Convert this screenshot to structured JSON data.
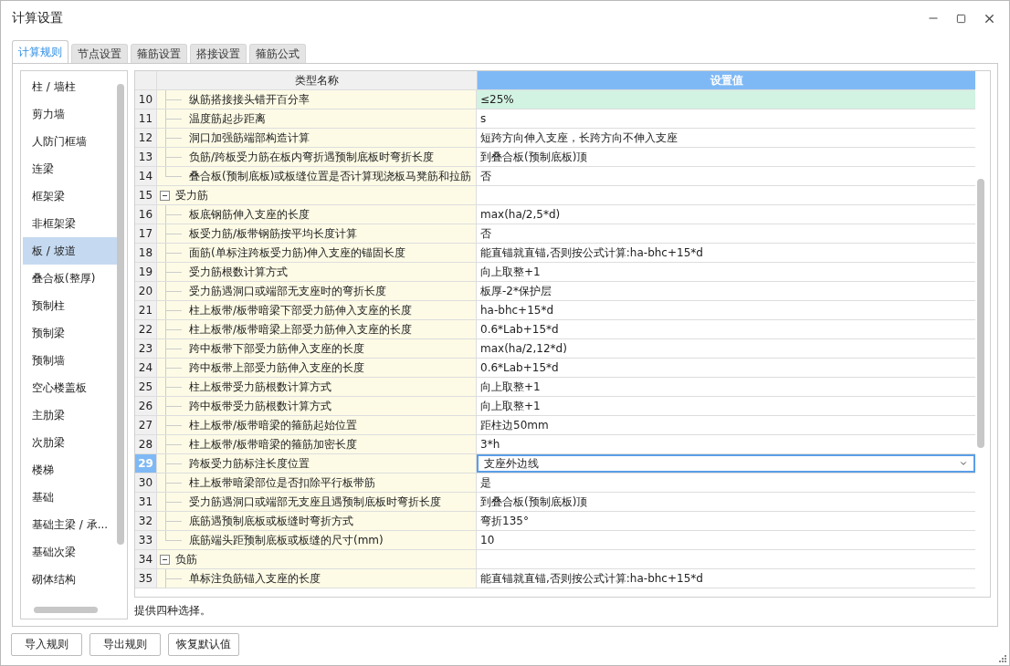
{
  "window": {
    "title": "计算设置"
  },
  "tabs": [
    {
      "label": "计算规则",
      "selected": true
    },
    {
      "label": "节点设置",
      "selected": false
    },
    {
      "label": "箍筋设置",
      "selected": false
    },
    {
      "label": "搭接设置",
      "selected": false
    },
    {
      "label": "箍筋公式",
      "selected": false
    }
  ],
  "sidebar": {
    "items": [
      {
        "label": "柱 / 墙柱",
        "selected": false
      },
      {
        "label": "剪力墙",
        "selected": false
      },
      {
        "label": "人防门框墙",
        "selected": false
      },
      {
        "label": "连梁",
        "selected": false
      },
      {
        "label": "框架梁",
        "selected": false
      },
      {
        "label": "非框架梁",
        "selected": false
      },
      {
        "label": "板 / 坡道",
        "selected": true
      },
      {
        "label": "叠合板(整厚)",
        "selected": false
      },
      {
        "label": "预制柱",
        "selected": false
      },
      {
        "label": "预制梁",
        "selected": false
      },
      {
        "label": "预制墙",
        "selected": false
      },
      {
        "label": "空心楼盖板",
        "selected": false
      },
      {
        "label": "主肋梁",
        "selected": false
      },
      {
        "label": "次肋梁",
        "selected": false
      },
      {
        "label": "楼梯",
        "selected": false
      },
      {
        "label": "基础",
        "selected": false
      },
      {
        "label": "基础主梁 / 承...",
        "selected": false
      },
      {
        "label": "基础次梁",
        "selected": false
      },
      {
        "label": "砌体结构",
        "selected": false
      }
    ]
  },
  "table": {
    "columns": [
      "类型名称",
      "设置值"
    ],
    "rows": [
      {
        "kind": "item",
        "number": "10",
        "name": "纵筋搭接接头错开百分率",
        "value": "≤25%",
        "modified": true,
        "selected": false,
        "last": false
      },
      {
        "kind": "item",
        "number": "11",
        "name": "温度筋起步距离",
        "value": "s",
        "modified": false,
        "selected": false,
        "last": false
      },
      {
        "kind": "item",
        "number": "12",
        "name": "洞口加强筋端部构造计算",
        "value": "短跨方向伸入支座，长跨方向不伸入支座",
        "modified": false,
        "selected": false,
        "last": false
      },
      {
        "kind": "item",
        "number": "13",
        "name": "负筋/跨板受力筋在板内弯折遇预制底板时弯折长度",
        "value": "到叠合板(预制底板)顶",
        "modified": false,
        "selected": false,
        "last": false
      },
      {
        "kind": "item",
        "number": "14",
        "name": "叠合板(预制底板)或板缝位置是否计算现浇板马凳筋和拉筋",
        "value": "否",
        "modified": false,
        "selected": false,
        "last": true
      },
      {
        "kind": "group",
        "number": "15",
        "name": "受力筋",
        "expanded": true,
        "selected": false
      },
      {
        "kind": "item",
        "number": "16",
        "name": "板底钢筋伸入支座的长度",
        "value": "max(ha/2,5*d)",
        "modified": false,
        "selected": false,
        "last": false
      },
      {
        "kind": "item",
        "number": "17",
        "name": "板受力筋/板带钢筋按平均长度计算",
        "value": "否",
        "modified": false,
        "selected": false,
        "last": false
      },
      {
        "kind": "item",
        "number": "18",
        "name": "面筋(单标注跨板受力筋)伸入支座的锚固长度",
        "value": "能直锚就直锚,否则按公式计算:ha-bhc+15*d",
        "modified": false,
        "selected": false,
        "last": false
      },
      {
        "kind": "item",
        "number": "19",
        "name": "受力筋根数计算方式",
        "value": "向上取整+1",
        "modified": false,
        "selected": false,
        "last": false
      },
      {
        "kind": "item",
        "number": "20",
        "name": "受力筋遇洞口或端部无支座时的弯折长度",
        "value": "板厚-2*保护层",
        "modified": false,
        "selected": false,
        "last": false
      },
      {
        "kind": "item",
        "number": "21",
        "name": "柱上板带/板带暗梁下部受力筋伸入支座的长度",
        "value": "ha-bhc+15*d",
        "modified": false,
        "selected": false,
        "last": false
      },
      {
        "kind": "item",
        "number": "22",
        "name": "柱上板带/板带暗梁上部受力筋伸入支座的长度",
        "value": "0.6*Lab+15*d",
        "modified": false,
        "selected": false,
        "last": false
      },
      {
        "kind": "item",
        "number": "23",
        "name": "跨中板带下部受力筋伸入支座的长度",
        "value": "max(ha/2,12*d)",
        "modified": false,
        "selected": false,
        "last": false
      },
      {
        "kind": "item",
        "number": "24",
        "name": "跨中板带上部受力筋伸入支座的长度",
        "value": "0.6*Lab+15*d",
        "modified": false,
        "selected": false,
        "last": false
      },
      {
        "kind": "item",
        "number": "25",
        "name": "柱上板带受力筋根数计算方式",
        "value": "向上取整+1",
        "modified": false,
        "selected": false,
        "last": false
      },
      {
        "kind": "item",
        "number": "26",
        "name": "跨中板带受力筋根数计算方式",
        "value": "向上取整+1",
        "modified": false,
        "selected": false,
        "last": false
      },
      {
        "kind": "item",
        "number": "27",
        "name": "柱上板带/板带暗梁的箍筋起始位置",
        "value": "距柱边50mm",
        "modified": false,
        "selected": false,
        "last": false
      },
      {
        "kind": "item",
        "number": "28",
        "name": "柱上板带/板带暗梁的箍筋加密长度",
        "value": "3*h",
        "modified": false,
        "selected": false,
        "last": false
      },
      {
        "kind": "item",
        "number": "29",
        "name": "跨板受力筋标注长度位置",
        "value": "支座外边线",
        "selected": true,
        "last": false
      },
      {
        "kind": "item",
        "number": "30",
        "name": "柱上板带暗梁部位是否扣除平行板带筋",
        "value": "是",
        "modified": false,
        "selected": false,
        "last": false
      },
      {
        "kind": "item",
        "number": "31",
        "name": "受力筋遇洞口或端部无支座且遇预制底板时弯折长度",
        "value": "到叠合板(预制底板)顶",
        "modified": false,
        "selected": false,
        "last": false
      },
      {
        "kind": "item",
        "number": "32",
        "name": "底筋遇预制底板或板缝时弯折方式",
        "value": "弯折135°",
        "modified": false,
        "selected": false,
        "last": false
      },
      {
        "kind": "item",
        "number": "33",
        "name": "底筋端头距预制底板或板缝的尺寸(mm)",
        "value": "10",
        "modified": false,
        "selected": false,
        "last": true
      },
      {
        "kind": "group",
        "number": "34",
        "name": "负筋",
        "expanded": true,
        "selected": false
      },
      {
        "kind": "item",
        "number": "35",
        "name": "单标注负筋锚入支座的长度",
        "value": "能直锚就直锚,否则按公式计算:ha-bhc+15*d",
        "modified": false,
        "selected": false,
        "last": false
      }
    ]
  },
  "description": "提供四种选择。",
  "buttons": [
    "导入规则",
    "导出规则",
    "恢复默认值"
  ]
}
